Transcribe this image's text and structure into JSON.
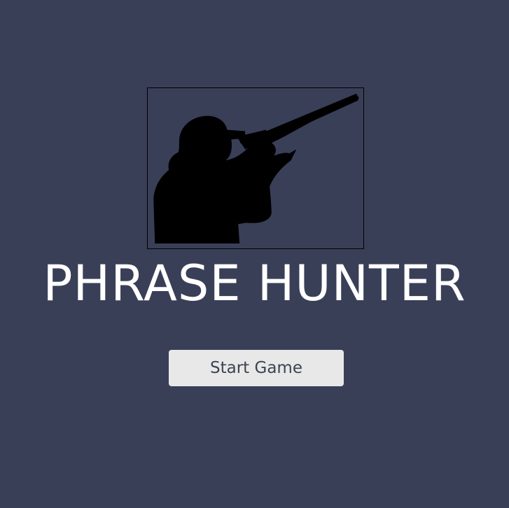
{
  "game": {
    "title": "PHRASE HUNTER",
    "start_button_label": "Start Game"
  },
  "banner": {
    "icon": "hunter-silhouette-icon"
  },
  "colors": {
    "background": "#3a3f58",
    "title": "#ffffff",
    "button_bg": "#e8e8e8",
    "button_text": "#3d4352"
  }
}
